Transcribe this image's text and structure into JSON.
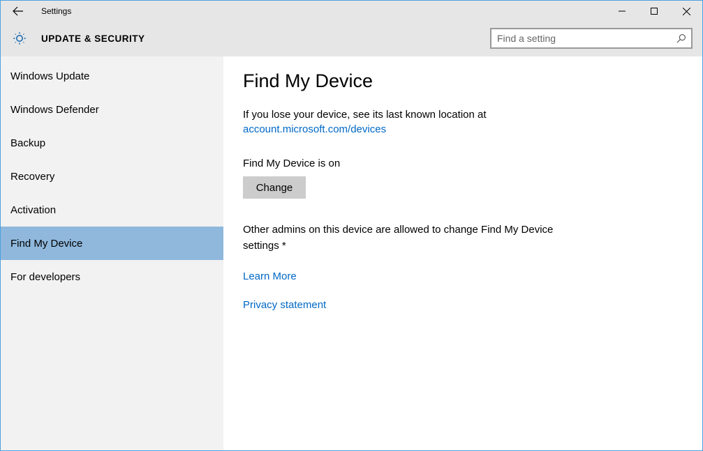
{
  "window": {
    "title": "Settings"
  },
  "header": {
    "category": "UPDATE & SECURITY"
  },
  "search": {
    "placeholder": "Find a setting"
  },
  "sidebar": {
    "items": [
      {
        "label": "Windows Update"
      },
      {
        "label": "Windows Defender"
      },
      {
        "label": "Backup"
      },
      {
        "label": "Recovery"
      },
      {
        "label": "Activation"
      },
      {
        "label": "Find My Device"
      },
      {
        "label": "For developers"
      }
    ],
    "selected_index": 5
  },
  "main": {
    "title": "Find My Device",
    "intro_text": "If you lose your device, see its last known location at",
    "intro_link": "account.microsoft.com/devices",
    "status_text": "Find My Device is on",
    "change_button_label": "Change",
    "admin_note": "Other admins on this device are allowed to change Find My Device settings *",
    "learn_more_link": "Learn More",
    "privacy_link": "Privacy statement"
  }
}
